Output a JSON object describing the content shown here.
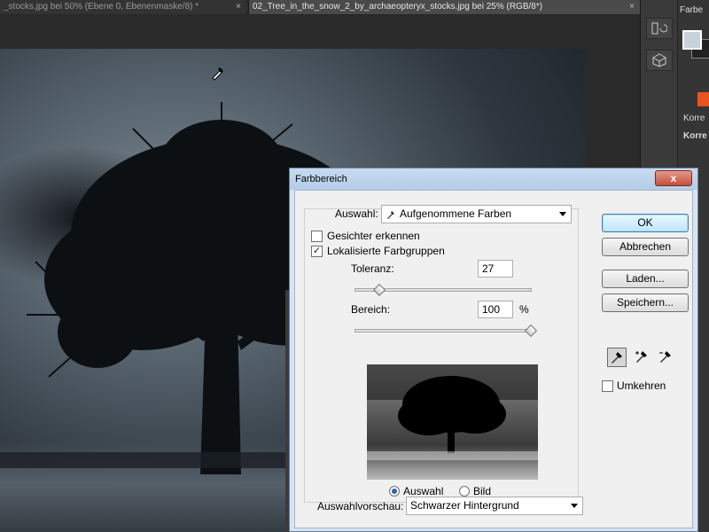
{
  "tabs": [
    {
      "label": "_stocks.jpg bei 50% (Ebene 0, Ebenenmaske/8) *",
      "close": "×"
    },
    {
      "label": "02_Tree_in_the_snow_2_by_archaeopteryx_stocks.jpg bei 25% (RGB/8*)",
      "close": "×"
    }
  ],
  "right_panel": {
    "farbe_label": "Farbe",
    "korr_label_1": "Korre",
    "korr_label_2": "Korre",
    "fg_color": "#c9d2db",
    "bg_color": "#222222",
    "accent_color": "#e8531f"
  },
  "dialog": {
    "title": "Farbbereich",
    "close_label": "x",
    "auswahl_label": "Auswahl:",
    "auswahl_value": "Aufgenommene Farben",
    "gesichter_label": "Gesichter erkennen",
    "gesichter_checked": false,
    "lokalisiert_label": "Lokalisierte Farbgruppen",
    "lokalisiert_checked": true,
    "toleranz_label": "Toleranz:",
    "toleranz_value": "27",
    "bereich_label": "Bereich:",
    "bereich_value": "100",
    "bereich_unit": "%",
    "radio_auswahl": "Auswahl",
    "radio_bild": "Bild",
    "radio_selected": "Auswahl",
    "buttons": {
      "ok": "OK",
      "cancel": "Abbrechen",
      "load": "Laden...",
      "save": "Speichern..."
    },
    "umkehren_label": "Umkehren",
    "umkehren_checked": false,
    "vorschau_label": "Auswahlvorschau:",
    "vorschau_value": "Schwarzer Hintergrund"
  }
}
